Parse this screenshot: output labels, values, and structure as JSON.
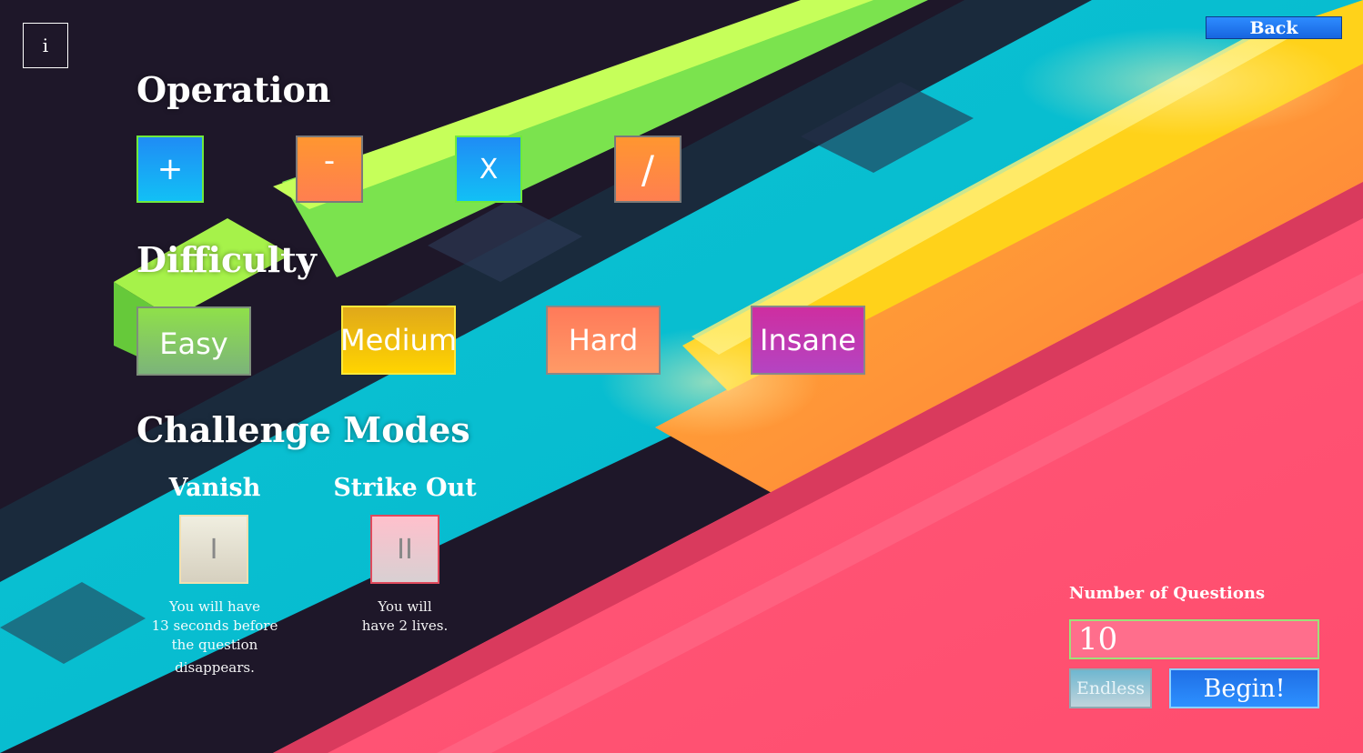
{
  "info_button": {
    "label": "i"
  },
  "back_button": {
    "label": "Back"
  },
  "operation": {
    "title": "Operation",
    "buttons": [
      {
        "label": "+",
        "selected": true
      },
      {
        "label": "-",
        "selected": false
      },
      {
        "label": "X",
        "selected": true
      },
      {
        "label": "/",
        "selected": false
      }
    ]
  },
  "difficulty": {
    "title": "Difficulty",
    "buttons": [
      {
        "label": "Easy"
      },
      {
        "label": "Medium"
      },
      {
        "label": "Hard"
      },
      {
        "label": "Insane"
      }
    ]
  },
  "challenge_modes": {
    "title": "Challenge Modes",
    "modes": [
      {
        "title": "Vanish",
        "button_label": "I",
        "description": [
          "You will have",
          "13 seconds before",
          "the question",
          "disappears."
        ]
      },
      {
        "title": "Strike Out",
        "button_label": "II",
        "description": [
          "You will",
          "have 2 lives."
        ]
      }
    ]
  },
  "questions": {
    "label": "Number of Questions",
    "value": "10",
    "endless_label": "Endless",
    "begin_label": "Begin!"
  },
  "colors": {
    "blue_button": "#1a7ff0",
    "orange_button": "#f98440",
    "easy": "#7ecf60",
    "medium": "#f2c200",
    "hard": "#fb8a62",
    "insane": "#c436b4",
    "input_bg": "#ff6e8c"
  }
}
